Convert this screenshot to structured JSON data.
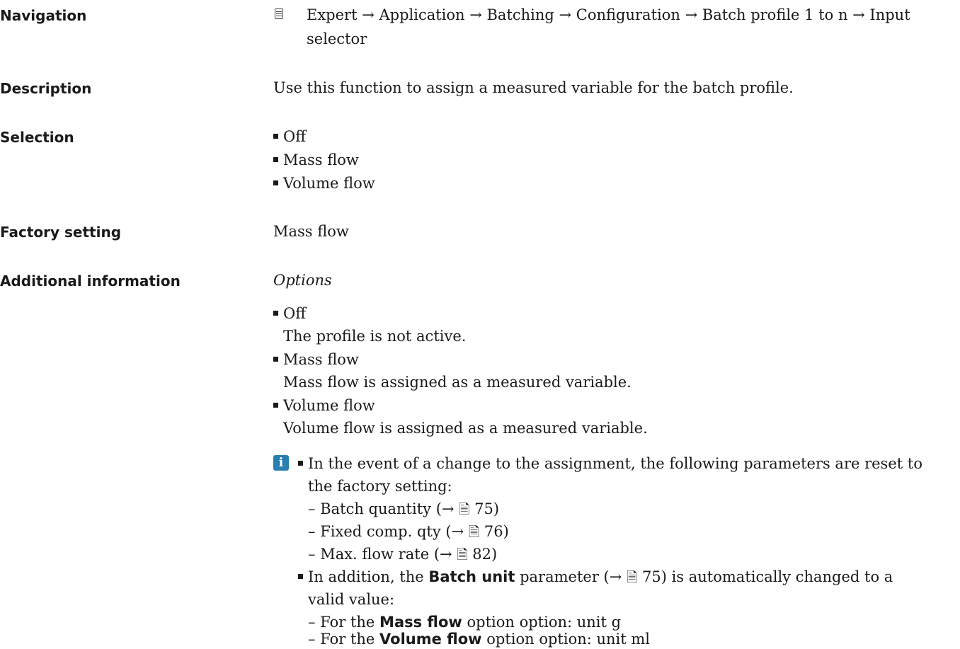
{
  "navigation": {
    "label": "Navigation",
    "path_line1": "Expert → Application → Batching → Configuration → Batch profile 1 to n → Input",
    "path_line2": "selector"
  },
  "description": {
    "label": "Description",
    "text": "Use this function to assign a measured variable for the batch profile."
  },
  "selection": {
    "label": "Selection",
    "options": [
      "Off",
      "Mass flow",
      "Volume flow"
    ]
  },
  "factory_setting": {
    "label": "Factory setting",
    "value": "Mass flow"
  },
  "additional_information": {
    "label": "Additional information",
    "heading": "Options",
    "options": [
      {
        "name": "Off",
        "desc": "The profile is not active."
      },
      {
        "name": "Mass flow",
        "desc": "Mass flow is assigned as a measured variable."
      },
      {
        "name": "Volume flow",
        "desc": "Volume flow is assigned as a measured variable."
      }
    ],
    "note": {
      "bullet1_line1": "In the event of a change to the assignment, the following parameters are reset to",
      "bullet1_line2": "the factory setting:",
      "params": [
        {
          "name": "Batch quantity",
          "page": "75"
        },
        {
          "name": "Fixed comp. qty",
          "page": "76"
        },
        {
          "name": "Max. flow rate",
          "page": "82"
        }
      ],
      "bullet2_pre": "In addition, the ",
      "bullet2_bold": "Batch unit",
      "bullet2_mid": " parameter (→ ",
      "bullet2_page": "75",
      "bullet2_post": ") is automatically changed to a",
      "bullet2_line2": "valid value:",
      "sub": [
        {
          "pre": "For the ",
          "bold": "Mass flow",
          "post": " option option: unit g"
        },
        {
          "pre": "For the ",
          "bold": "Volume flow",
          "post": " option option: unit ml"
        }
      ]
    }
  }
}
